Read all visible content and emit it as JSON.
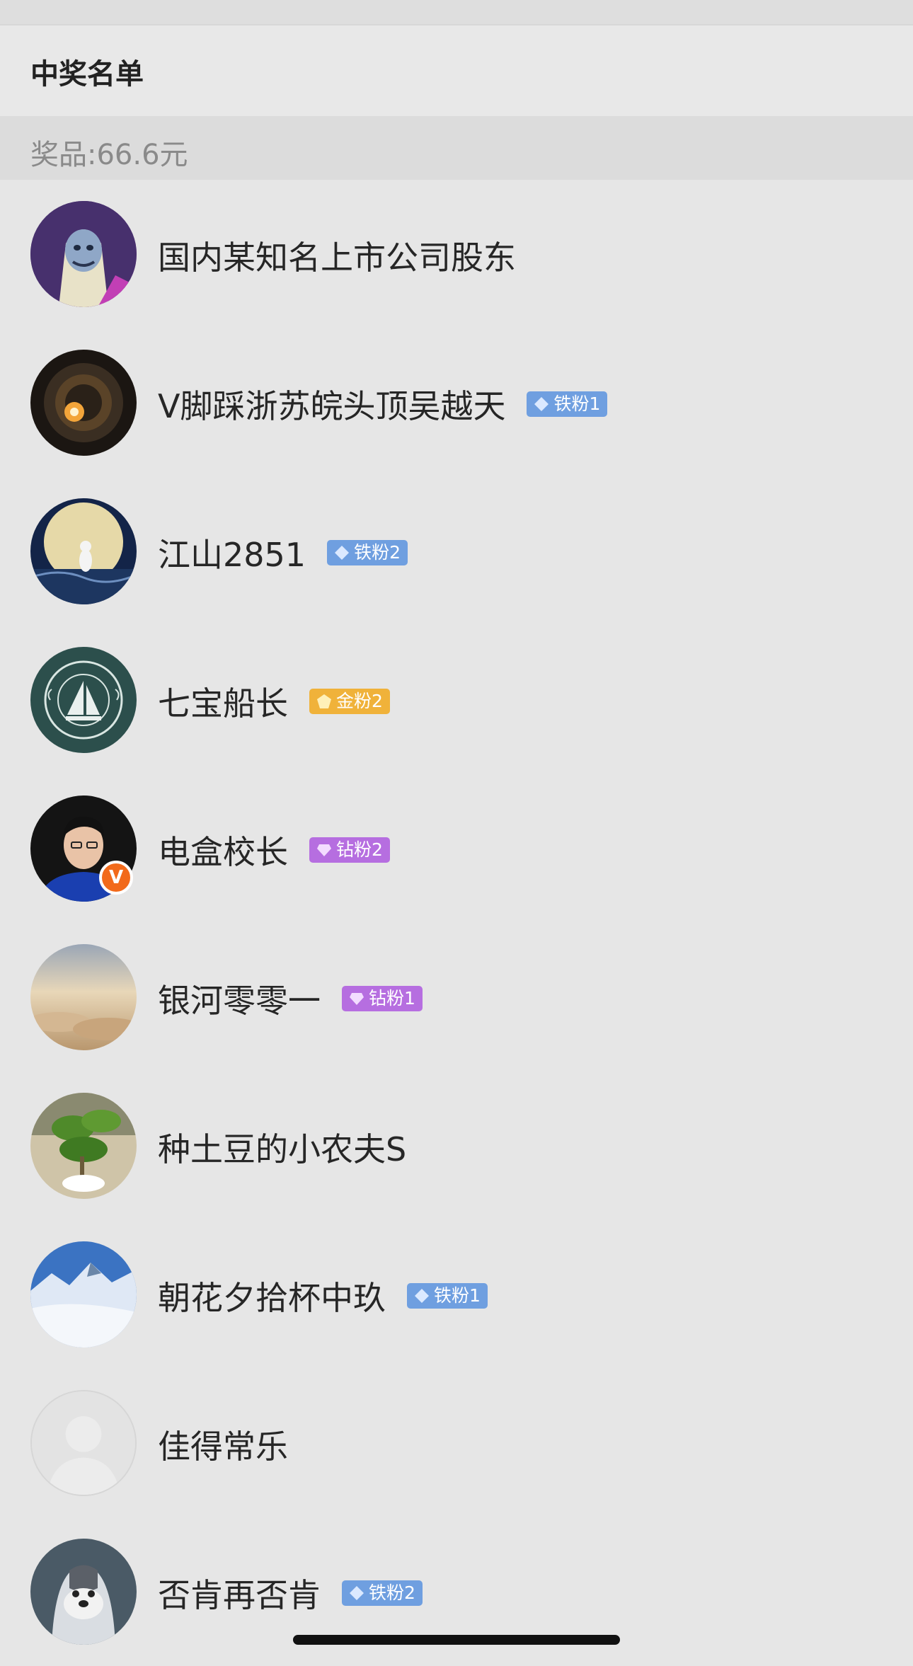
{
  "header": {
    "title": "中奖名单"
  },
  "prize": {
    "label": "奖品:66.6元"
  },
  "winners": [
    {
      "name": "国内某知名上市公司股东",
      "badge": null,
      "verified": false
    },
    {
      "name": "V脚踩浙苏皖头顶吴越天",
      "badge": {
        "label": "铁粉1",
        "type": "iron"
      },
      "verified": false
    },
    {
      "name": "江山2851",
      "badge": {
        "label": "铁粉2",
        "type": "iron"
      },
      "verified": false
    },
    {
      "name": "七宝船长",
      "badge": {
        "label": "金粉2",
        "type": "gold"
      },
      "verified": false
    },
    {
      "name": "电盒校长",
      "badge": {
        "label": "钻粉2",
        "type": "drill"
      },
      "verified": true,
      "verified_mark": "V"
    },
    {
      "name": "银河零零一",
      "badge": {
        "label": "钻粉1",
        "type": "drill"
      },
      "verified": false
    },
    {
      "name": "种土豆的小农夫S",
      "badge": null,
      "verified": false
    },
    {
      "name": "朝花夕拾杯中玖",
      "badge": {
        "label": "铁粉1",
        "type": "iron"
      },
      "verified": false
    },
    {
      "name": "佳得常乐",
      "badge": null,
      "verified": false
    },
    {
      "name": "否肯再否肯",
      "badge": {
        "label": "铁粉2",
        "type": "iron"
      },
      "verified": false
    }
  ],
  "colors": {
    "iron": "#6f9fe0",
    "gold": "#f0b23a",
    "drill": "#b66ee0",
    "verified": "#f26a1b"
  }
}
